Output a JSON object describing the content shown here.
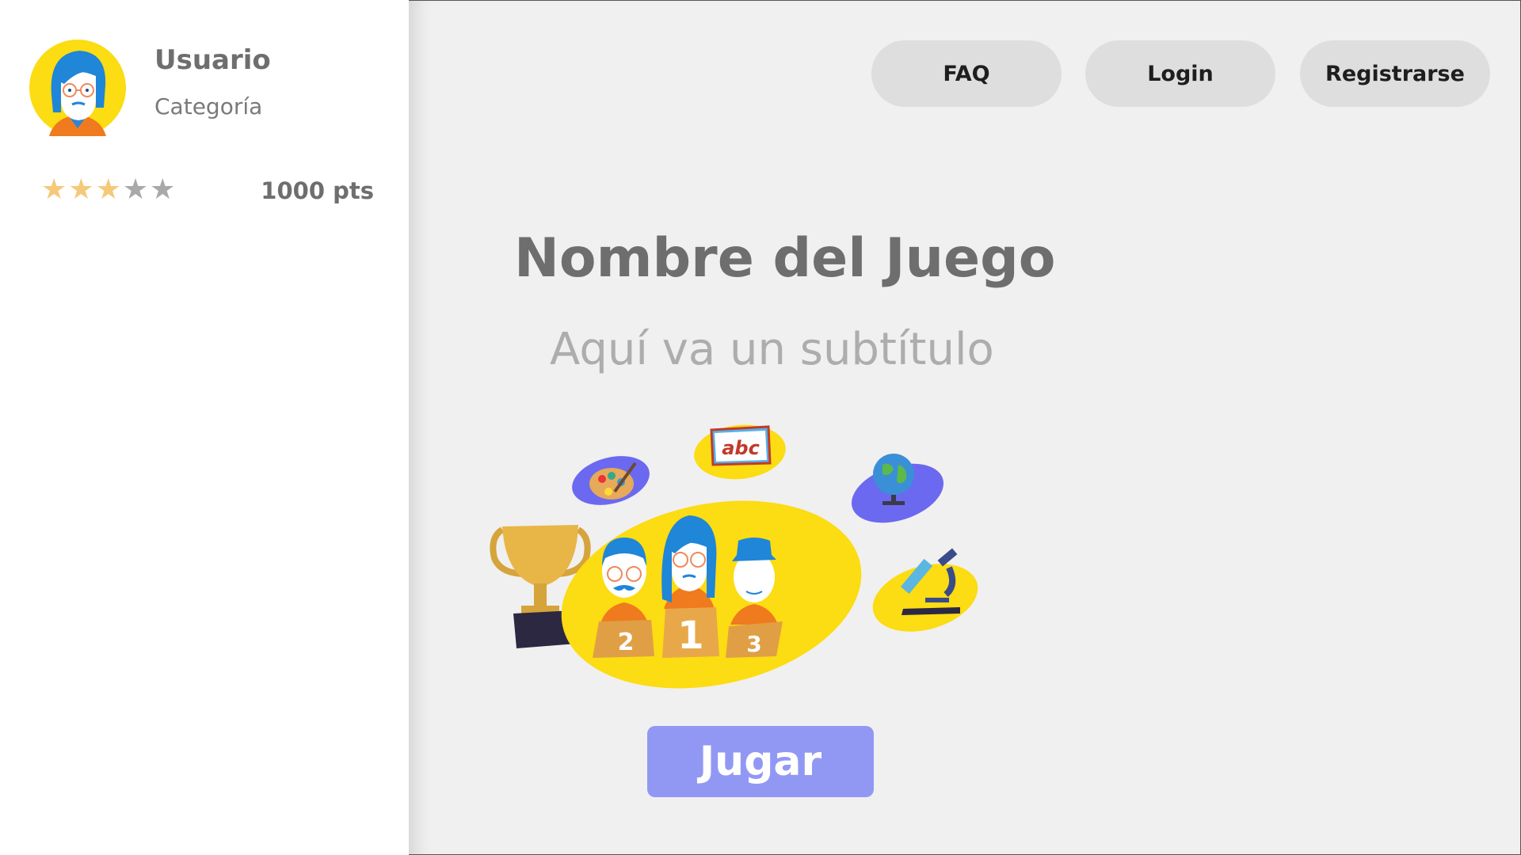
{
  "user": {
    "name": "Usuario",
    "category": "Categoría",
    "rating": 3,
    "rating_max": 5,
    "points": "1000 pts"
  },
  "nav": {
    "faq": "FAQ",
    "login": "Login",
    "register": "Registrarse"
  },
  "game": {
    "title": "Nombre del Juego",
    "subtitle": "Aquí va un subtítulo",
    "play": "Jugar"
  },
  "illustration": {
    "book_text": "abc",
    "podium_labels": [
      "2",
      "1",
      "3"
    ]
  },
  "colors": {
    "accent_yellow": "#fcdc12",
    "accent_purple": "#6b69f0",
    "play_button": "#9198f4",
    "star_filled": "#f5c97a",
    "star_empty": "#a9a9a9"
  }
}
